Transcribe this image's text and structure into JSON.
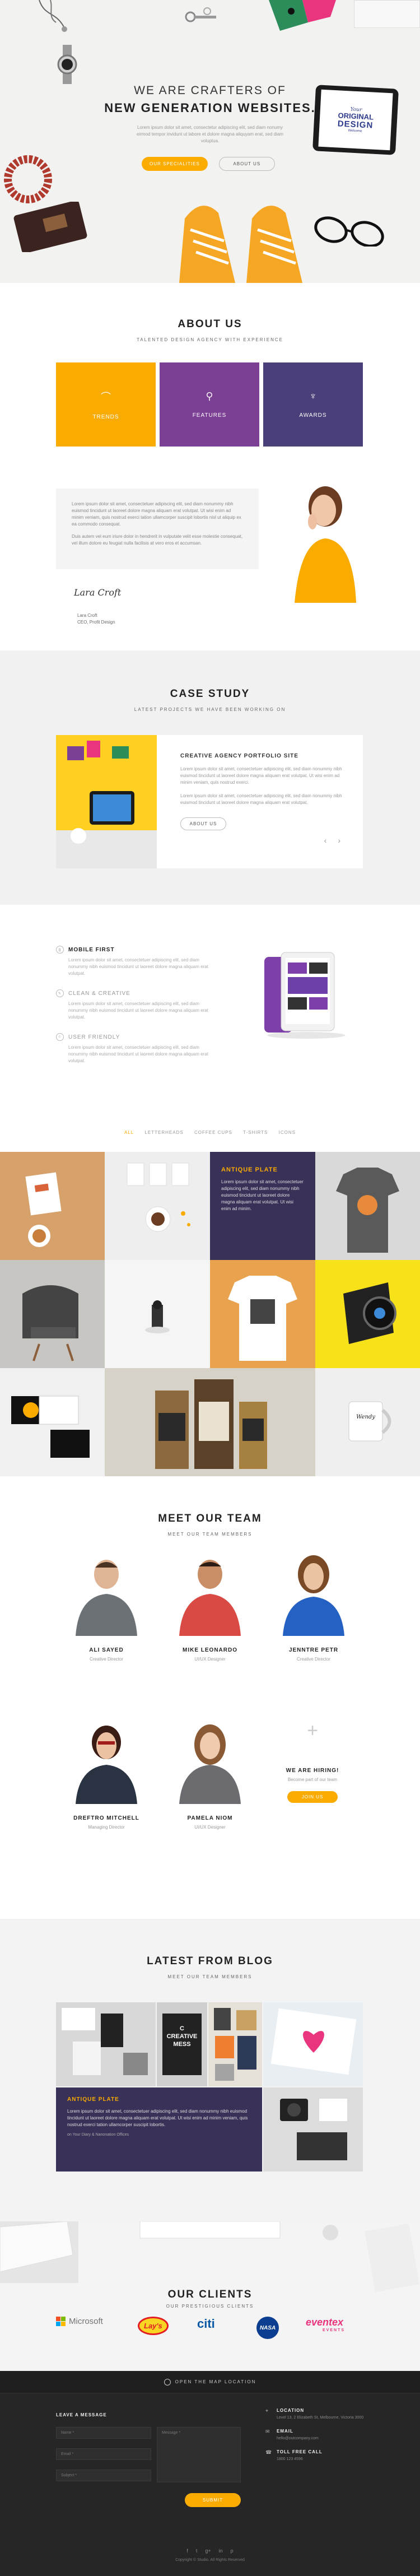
{
  "hero": {
    "title_line1": "WE ARE CRAFTERS OF",
    "title_line2": "NEW GENERATION WEBSITES.",
    "subtitle": "Lorem ipsum dolor sit amet, consectetur adipiscing elit, sed diam nonumy eirmod tempor invidunt ut labore et dolore magna aliquyam erat, sed diam voluptua.",
    "btn_primary": "OUR SPECIALITIES",
    "btn_secondary": "ABOUT US",
    "tablet_line1": "Your",
    "tablet_line2": "ORIGINAL",
    "tablet_line3": "DESIGN",
    "tablet_line4": "Welcome"
  },
  "about": {
    "title": "ABOUT US",
    "subtitle": "TALENTED DESIGN AGENCY WITH EXPERIENCE",
    "features": [
      {
        "label": "TRENDS",
        "color": "#f9ab00"
      },
      {
        "label": "FEATURES",
        "color": "#7b3f94"
      },
      {
        "label": "AWARDS",
        "color": "#4a3f78"
      }
    ],
    "quote_p1": "Lorem ipsum dolor sit amet, consectetuer adipiscing elit, sed diam nonummy nibh euismod tincidunt ut laoreet dolore magna aliquam erat volutpat. Ut wisi enim ad minim veniam, quis nostrud exerci tation ullamcorper suscipit lobortis nisl ut aliquip ex ea commodo consequat.",
    "quote_p2": "Duis autem vel eum iriure dolor in hendrerit in vulputate velit esse molestie consequat, vel illum dolore eu feugiat nulla facilisis at vero eros et accumsan.",
    "signature": "Lara Croft",
    "sign_name": "Lara Croft",
    "sign_role": "CEO, Profit Design"
  },
  "case": {
    "title": "CASE STUDY",
    "subtitle": "LATEST PROJECTS WE HAVE BEEN WORKING ON",
    "card_title": "CREATIVE AGENCY PORTFOLIO SITE",
    "p1": "Lorem ipsum dolor sit amet, consectetuer adipiscing elit, sed diam nonummy nibh euismod tincidunt ut laoreet dolore magna aliquam erat volutpat. Ut wisi enim ad minim veniam, quis nostrud exerci.",
    "p2": "Lorem ipsum dolor sit amet, consectetuer adipiscing elit, sed diam nonummy nibh euismod tincidunt ut laoreet dolore magna aliquam erat volutpat.",
    "button": "ABOUT US",
    "prev": "‹",
    "next": "›"
  },
  "features_list": [
    {
      "title": "MOBILE FIRST",
      "text": "Lorem ipsum dolor sit amet, consectetuer adipiscing elit, sed diam nonummy nibh euismod tincidunt ut laoreet dolore magna aliquam erat volutpat."
    },
    {
      "title": "CLEAN & CREATIVE",
      "text": "Lorem ipsum dolor sit amet, consectetuer adipiscing elit, sed diam nonummy nibh euismod tincidunt ut laoreet dolore magna aliquam erat volutpat."
    },
    {
      "title": "USER FRIENDLY",
      "text": "Lorem ipsum dolor sit amet, consectetuer adipiscing elit, sed diam nonummy nibh euismod tincidunt ut laoreet dolore magna aliquam erat volutpat."
    }
  ],
  "portfolio": {
    "filters": [
      "ALL",
      "LETTERHEADS",
      "COFFEE CUPS",
      "T-SHIRTS",
      "ICONS"
    ],
    "overlay_title": "ANTIQUE PLATE",
    "overlay_text": "Lorem ipsum dolor sit amet, consectetuer adipiscing elit, sed diam nonummy nibh euismod tincidunt ut laoreet dolore magna aliquam erat volutpat. Ut wisi enim ad minim.",
    "mug_text": "Wendy"
  },
  "team": {
    "title": "MEET OUR TEAM",
    "subtitle": "MEET OUR TEAM MEMBERS",
    "members": [
      {
        "name": "ALI SAYED",
        "role": "Creative Director"
      },
      {
        "name": "MIKE LEONARDO",
        "role": "UI/UX Designer"
      },
      {
        "name": "JENNTRE PETR",
        "role": "Creative Director"
      },
      {
        "name": "DREFTRO MITCHELL",
        "role": "Managing Director"
      },
      {
        "name": "PAMELA NIOM",
        "role": "UI/UX Designer"
      }
    ],
    "hiring_title": "WE ARE HIRING!",
    "hiring_sub": "Become part of our team",
    "hiring_btn": "JOIN US"
  },
  "blog": {
    "title": "LATEST FROM BLOG",
    "subtitle": "MEET OUR TEAM MEMBERS",
    "overlay_title": "ANTIQUE PLATE",
    "overlay_text": "Lorem ipsum dolor sit amet, consectetuer adipiscing elit, sed diam nonummy nibh euismod tincidunt ut laoreet dolore magna aliquam erat volutpat. Ut wisi enim ad minim veniam, quis nostrud exerci tation ullamcorper suscipit lobortis.",
    "overlay_meta": "on Your Diary & Nanonation Offices",
    "poster_text": "C CREATIVE MESS"
  },
  "clients": {
    "title": "OUR CLIENTS",
    "subtitle": "OUR PRESTIGIOUS CLIENTS",
    "logos": [
      "Microsoft",
      "Lay's",
      "citi",
      "NASA",
      "eventex"
    ],
    "logo_sub": "EVENTS"
  },
  "map": {
    "label": "OPEN THE MAP LOCATION"
  },
  "footer": {
    "form_title": "LEAVE A MESSAGE",
    "ph_name": "Name *",
    "ph_email": "Email *",
    "ph_subject": "Subject *",
    "ph_message": "Message *",
    "send": "SUBMIT",
    "location_k": "LOCATION",
    "location_v": "Level 13, 2 Elizabeth St, Melbourne, Victoria 3000",
    "email_k": "EMAIL",
    "email_v": "hello@outcompany.com",
    "phone_k": "TOLL FREE CALL",
    "phone_v": "1800 123 4596",
    "social": [
      "f",
      "t",
      "g+",
      "in",
      "p"
    ],
    "copyright": "Copyright © Studio. All Rights Reserved"
  }
}
